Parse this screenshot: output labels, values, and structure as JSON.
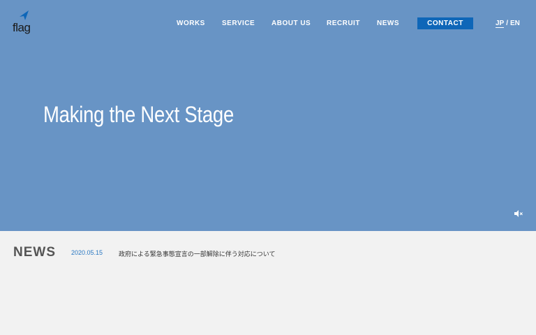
{
  "brand": {
    "name": "flag"
  },
  "nav": {
    "items": [
      {
        "label": "WORKS"
      },
      {
        "label": "SERVICE"
      },
      {
        "label": "ABOUT US"
      },
      {
        "label": "RECRUIT"
      },
      {
        "label": "NEWS"
      }
    ],
    "contact_label": "CONTACT",
    "lang": {
      "jp": "JP",
      "separator": "/",
      "en": "EN"
    }
  },
  "hero": {
    "title": "Making the Next Stage",
    "mute_icon": "speaker-muted-icon"
  },
  "news": {
    "heading": "NEWS",
    "items": [
      {
        "date": "2020.05.15",
        "text": "政府による緊急事態宣言の一部解除に伴う対応について"
      }
    ]
  },
  "colors": {
    "hero_bg": "#6894c5",
    "accent": "#0e66b8",
    "news_date": "#2a78c2",
    "page_bg": "#f2f2f2"
  }
}
